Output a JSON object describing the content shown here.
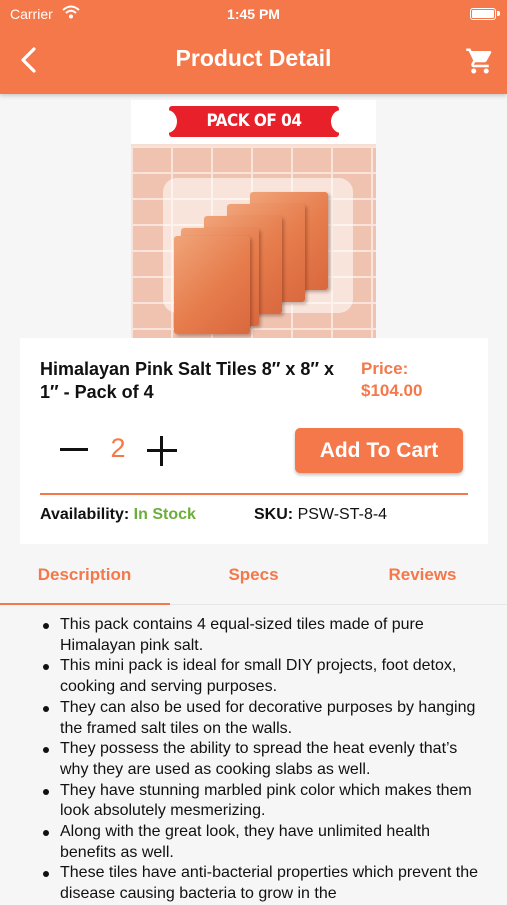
{
  "status": {
    "carrier": "Carrier",
    "time": "1:45 PM"
  },
  "header": {
    "title": "Product Detail",
    "accent": "#f4784a"
  },
  "image": {
    "banner": "PACK OF 04"
  },
  "product": {
    "name": "Himalayan Pink Salt Tiles  8″ x 8″ x 1″ - Pack of 4",
    "price_label": "Price:",
    "price": "$104.00",
    "quantity": "2",
    "add_to_cart": "Add To Cart",
    "availability_label": "Availability:",
    "availability": "In Stock",
    "availability_color": "#6cae3a",
    "sku_label": "SKU:",
    "sku": "PSW-ST-8-4"
  },
  "tabs": [
    {
      "label": "Description",
      "active": true
    },
    {
      "label": "Specs",
      "active": false
    },
    {
      "label": "Reviews",
      "active": false
    }
  ],
  "description": [
    "This pack contains 4 equal-sized tiles made of pure Himalayan pink salt.",
    "This mini pack is ideal for small DIY projects, foot detox, cooking and serving purposes.",
    "They can also be used for decorative purposes by hanging the framed salt tiles on the walls.",
    "They possess the ability to spread the heat evenly that’s why they are used as cooking slabs as well.",
    "They have stunning marbled pink color which makes them look absolutely mesmerizing.",
    "Along with the great look, they have unlimited health benefits as well.",
    "These tiles have anti-bacterial properties which prevent the disease causing bacteria to grow in the"
  ]
}
